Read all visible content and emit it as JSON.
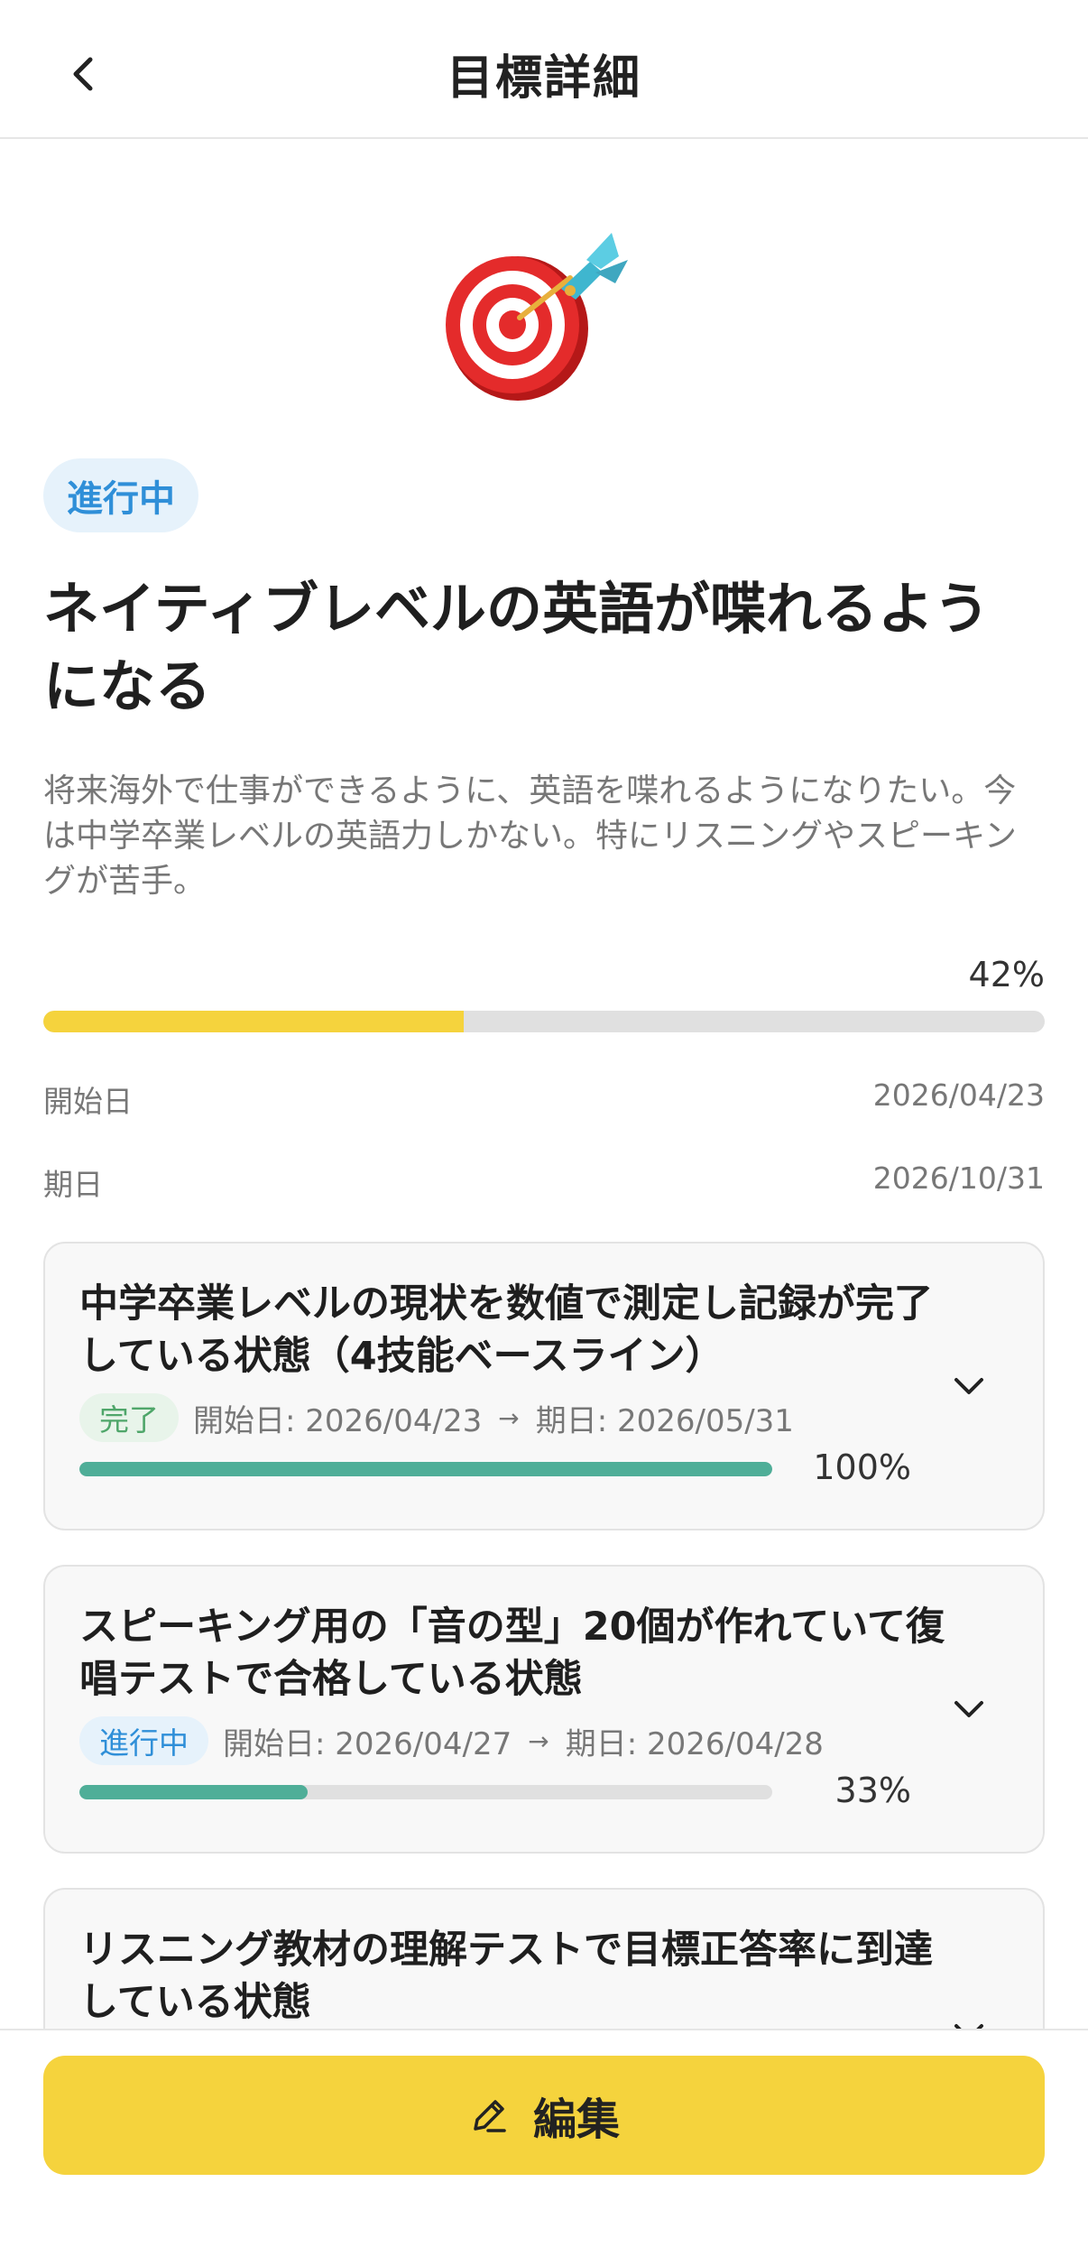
{
  "header": {
    "title": "目標詳細"
  },
  "goal": {
    "status": "進行中",
    "title": "ネイティブレベルの英語が喋れるようになる",
    "description": "将来海外で仕事ができるように、英語を喋れるようになりたい。今は中学卒業レベルの英語力しかない。特にリスニングやスピーキングが苦手。",
    "progress_label": "42%",
    "progress": 0.42,
    "start_label": "開始日",
    "start_date": "2026/04/23",
    "due_label": "期日",
    "due_date": "2026/10/31"
  },
  "milestones": [
    {
      "title": "中学卒業レベルの現状を数値で測定し記録が完了している状態（4技能ベースライン）",
      "badge": "完了",
      "start": "開始日: 2026/04/23",
      "due": "期日: 2026/05/31",
      "progress_label": "100%",
      "progress": 1.0
    },
    {
      "title": "スピーキング用の「音の型」20個が作れていて復唱テストで合格している状態",
      "badge": "進行中",
      "start": "開始日: 2026/04/27",
      "due": "期日: 2026/04/28",
      "progress_label": "33%",
      "progress": 0.33
    },
    {
      "title": "リスニング教材の理解テストで目標正答率に到達している状態"
    }
  ],
  "footer": {
    "edit_label": "編集"
  },
  "colors": {
    "accent": "#f5d33d",
    "progress_green": "#4fae98",
    "status_blue": "#2f8fd8",
    "done_green": "#4fa66a"
  },
  "icons": [
    "back-chevron-icon",
    "target-dart-icon",
    "chevron-down-icon",
    "pencil-icon"
  ]
}
